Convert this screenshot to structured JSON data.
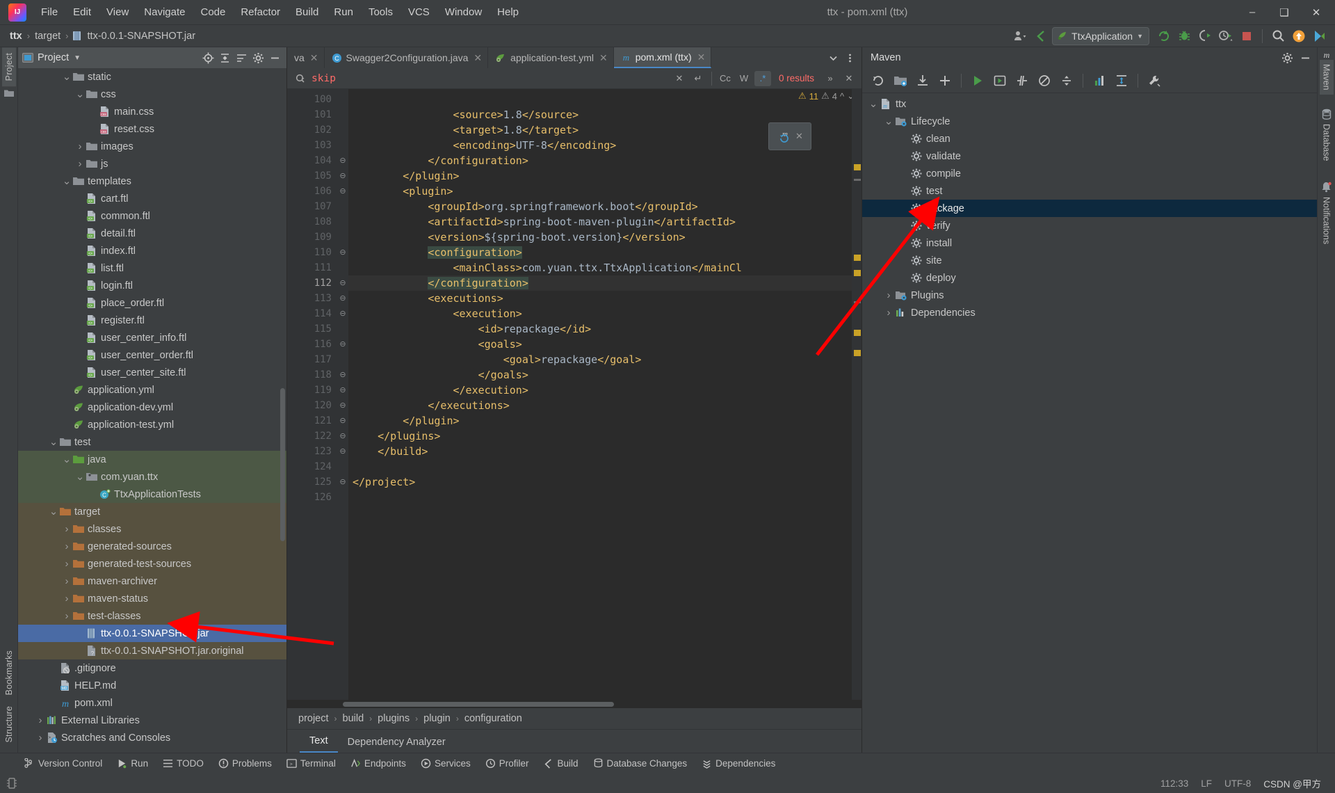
{
  "window": {
    "title": "ttx - pom.xml (ttx)",
    "logo_alt": "intellij-idea-logo",
    "minimize": "—",
    "maximize": "❐",
    "close": "✕"
  },
  "menubar": [
    "File",
    "Edit",
    "View",
    "Navigate",
    "Code",
    "Refactor",
    "Build",
    "Run",
    "Tools",
    "VCS",
    "Window",
    "Help"
  ],
  "navbar": {
    "crumbs": [
      "ttx",
      "target",
      "ttx-0.0.1-SNAPSHOT.jar"
    ],
    "separator": "›",
    "run_config": "TtxApplication",
    "buttons": [
      "profile-icon",
      "updates-icon",
      "run-icon",
      "debug-icon",
      "coverage-icon",
      "profiler-icon",
      "stop-icon",
      "search-everywhere-icon",
      "notification-icon",
      "feedback-icon"
    ]
  },
  "left_rail": {
    "tabs": [
      "Project",
      "Bookmarks",
      "Structure"
    ]
  },
  "project_panel": {
    "title": "Project",
    "header_icons": [
      "locate-icon",
      "collapse-all-icon",
      "expand-icon",
      "settings-icon",
      "hide-icon"
    ],
    "tree": [
      {
        "label": "static",
        "indent": 3,
        "arrow": "down",
        "icon": "folder-gray",
        "state": "normal"
      },
      {
        "label": "css",
        "indent": 4,
        "arrow": "down",
        "icon": "folder-gray",
        "state": "normal"
      },
      {
        "label": "main.css",
        "indent": 5,
        "arrow": "none",
        "icon": "css-file",
        "state": "normal"
      },
      {
        "label": "reset.css",
        "indent": 5,
        "arrow": "none",
        "icon": "css-file",
        "state": "normal"
      },
      {
        "label": "images",
        "indent": 4,
        "arrow": "right",
        "icon": "folder-gray",
        "state": "normal"
      },
      {
        "label": "js",
        "indent": 4,
        "arrow": "right",
        "icon": "folder-gray",
        "state": "normal"
      },
      {
        "label": "templates",
        "indent": 3,
        "arrow": "down",
        "icon": "folder-gray",
        "state": "normal"
      },
      {
        "label": "cart.ftl",
        "indent": 4,
        "arrow": "none",
        "icon": "ftl-file",
        "state": "normal"
      },
      {
        "label": "common.ftl",
        "indent": 4,
        "arrow": "none",
        "icon": "ftl-file",
        "state": "normal"
      },
      {
        "label": "detail.ftl",
        "indent": 4,
        "arrow": "none",
        "icon": "ftl-file",
        "state": "normal"
      },
      {
        "label": "index.ftl",
        "indent": 4,
        "arrow": "none",
        "icon": "ftl-file",
        "state": "normal"
      },
      {
        "label": "list.ftl",
        "indent": 4,
        "arrow": "none",
        "icon": "ftl-file",
        "state": "normal"
      },
      {
        "label": "login.ftl",
        "indent": 4,
        "arrow": "none",
        "icon": "ftl-file",
        "state": "normal"
      },
      {
        "label": "place_order.ftl",
        "indent": 4,
        "arrow": "none",
        "icon": "ftl-file",
        "state": "normal"
      },
      {
        "label": "register.ftl",
        "indent": 4,
        "arrow": "none",
        "icon": "ftl-file",
        "state": "normal"
      },
      {
        "label": "user_center_info.ftl",
        "indent": 4,
        "arrow": "none",
        "icon": "ftl-file",
        "state": "normal"
      },
      {
        "label": "user_center_order.ftl",
        "indent": 4,
        "arrow": "none",
        "icon": "ftl-file",
        "state": "normal"
      },
      {
        "label": "user_center_site.ftl",
        "indent": 4,
        "arrow": "none",
        "icon": "ftl-file",
        "state": "normal"
      },
      {
        "label": "application.yml",
        "indent": 3,
        "arrow": "none",
        "icon": "yml-file",
        "state": "normal"
      },
      {
        "label": "application-dev.yml",
        "indent": 3,
        "arrow": "none",
        "icon": "yml-file",
        "state": "normal"
      },
      {
        "label": "application-test.yml",
        "indent": 3,
        "arrow": "none",
        "icon": "yml-file",
        "state": "normal"
      },
      {
        "label": "test",
        "indent": 2,
        "arrow": "down",
        "icon": "folder-gray",
        "state": "normal"
      },
      {
        "label": "java",
        "indent": 3,
        "arrow": "down",
        "icon": "folder-green",
        "state": "test"
      },
      {
        "label": "com.yuan.ttx",
        "indent": 4,
        "arrow": "down",
        "icon": "package",
        "state": "test"
      },
      {
        "label": "TtxApplicationTests",
        "indent": 5,
        "arrow": "none",
        "icon": "test-class",
        "state": "test"
      },
      {
        "label": "target",
        "indent": 2,
        "arrow": "down",
        "icon": "folder-orange",
        "state": "target"
      },
      {
        "label": "classes",
        "indent": 3,
        "arrow": "right",
        "icon": "folder-orange",
        "state": "target"
      },
      {
        "label": "generated-sources",
        "indent": 3,
        "arrow": "right",
        "icon": "folder-orange",
        "state": "target"
      },
      {
        "label": "generated-test-sources",
        "indent": 3,
        "arrow": "right",
        "icon": "folder-orange",
        "state": "target"
      },
      {
        "label": "maven-archiver",
        "indent": 3,
        "arrow": "right",
        "icon": "folder-orange",
        "state": "target"
      },
      {
        "label": "maven-status",
        "indent": 3,
        "arrow": "right",
        "icon": "folder-orange",
        "state": "target"
      },
      {
        "label": "test-classes",
        "indent": 3,
        "arrow": "right",
        "icon": "folder-orange",
        "state": "target"
      },
      {
        "label": "ttx-0.0.1-SNAPSHOT.jar",
        "indent": 4,
        "arrow": "none",
        "icon": "jar-file",
        "state": "selected"
      },
      {
        "label": "ttx-0.0.1-SNAPSHOT.jar.original",
        "indent": 4,
        "arrow": "none",
        "icon": "unknown-file",
        "state": "target"
      },
      {
        "label": ".gitignore",
        "indent": 2,
        "arrow": "none",
        "icon": "gitignore-file",
        "state": "normal"
      },
      {
        "label": "HELP.md",
        "indent": 2,
        "arrow": "none",
        "icon": "md-file",
        "state": "normal"
      },
      {
        "label": "pom.xml",
        "indent": 2,
        "arrow": "none",
        "icon": "maven-file",
        "state": "normal"
      },
      {
        "label": "External Libraries",
        "indent": 1,
        "arrow": "right",
        "icon": "libraries",
        "state": "normal"
      },
      {
        "label": "Scratches and Consoles",
        "indent": 1,
        "arrow": "right",
        "icon": "scratches",
        "state": "normal"
      }
    ]
  },
  "editor": {
    "tabs": [
      {
        "label": "va",
        "icon": "java-file",
        "active": false,
        "truncated": true
      },
      {
        "label": "Swagger2Configuration.java",
        "icon": "java-class",
        "active": false
      },
      {
        "label": "application-test.yml",
        "icon": "yml-file",
        "active": false
      },
      {
        "label": "pom.xml (ttx)",
        "icon": "maven-file",
        "active": true
      }
    ],
    "tab_right_icons": [
      "chevron-down-icon",
      "more-options-icon"
    ],
    "find": {
      "value": "skip",
      "results": "0 results",
      "case_label": "Cc",
      "words_label": "W",
      "regex_label": ".*",
      "close_label": "✕",
      "clear_label": "✕",
      "newline_label": "↵",
      "expand_label": "»"
    },
    "inspections": {
      "warnings": "11",
      "weak_warnings": "4"
    },
    "lines": [
      {
        "num": "100",
        "indent": 0,
        "text": "",
        "partial": true
      },
      {
        "num": "101",
        "indent": 4,
        "text": "<source>1.8</source>"
      },
      {
        "num": "102",
        "indent": 4,
        "text": "<target>1.8</target>"
      },
      {
        "num": "103",
        "indent": 4,
        "text": "<encoding>UTF-8</encoding>"
      },
      {
        "num": "104",
        "indent": 3,
        "text": "</configuration>",
        "fold": true
      },
      {
        "num": "105",
        "indent": 2,
        "text": "</plugin>",
        "fold": true
      },
      {
        "num": "106",
        "indent": 2,
        "text": "<plugin>",
        "fold": true
      },
      {
        "num": "107",
        "indent": 3,
        "text": "<groupId>org.springframework.boot</groupId>"
      },
      {
        "num": "108",
        "indent": 3,
        "text": "<artifactId>spring-boot-maven-plugin</artifactId>"
      },
      {
        "num": "109",
        "indent": 3,
        "text": "<version>${spring-boot.version}</version>"
      },
      {
        "num": "110",
        "indent": 3,
        "text": "<configuration>",
        "fold": true,
        "highlight": true
      },
      {
        "num": "111",
        "indent": 4,
        "text": "<mainClass>com.yuan.ttx.TtxApplication</mainCl"
      },
      {
        "num": "112",
        "indent": 3,
        "text": "</configuration>",
        "fold": true,
        "highlight": true,
        "current": true
      },
      {
        "num": "113",
        "indent": 3,
        "text": "<executions>",
        "fold": true
      },
      {
        "num": "114",
        "indent": 4,
        "text": "<execution>",
        "fold": true
      },
      {
        "num": "115",
        "indent": 5,
        "text": "<id>repackage</id>"
      },
      {
        "num": "116",
        "indent": 5,
        "text": "<goals>",
        "fold": true
      },
      {
        "num": "117",
        "indent": 6,
        "text": "<goal>repackage</goal>"
      },
      {
        "num": "118",
        "indent": 5,
        "text": "</goals>",
        "fold": true
      },
      {
        "num": "119",
        "indent": 4,
        "text": "</execution>",
        "fold": true
      },
      {
        "num": "120",
        "indent": 3,
        "text": "</executions>",
        "fold": true
      },
      {
        "num": "121",
        "indent": 2,
        "text": "</plugin>",
        "fold": true
      },
      {
        "num": "122",
        "indent": 1,
        "text": "</plugins>",
        "fold": true
      },
      {
        "num": "123",
        "indent": 1,
        "text": "</build>",
        "fold": true
      },
      {
        "num": "124",
        "indent": 0,
        "text": ""
      },
      {
        "num": "125",
        "indent": 0,
        "text": "</project>",
        "fold": true
      },
      {
        "num": "126",
        "indent": 0,
        "text": ""
      }
    ],
    "breadcrumbs": [
      "project",
      "build",
      "plugins",
      "plugin",
      "configuration"
    ],
    "breadcrumb_separator": "›",
    "subtabs": [
      {
        "label": "Text",
        "active": true
      },
      {
        "label": "Dependency Analyzer",
        "active": false
      }
    ]
  },
  "maven_panel": {
    "title": "Maven",
    "header_icons": [
      "settings-icon",
      "hide-icon"
    ],
    "toolbar_icons": [
      "reload-icon",
      "add-module-icon",
      "download-sources-icon",
      "add-icon",
      "run-icon",
      "run-configuration-icon",
      "skip-tests-icon",
      "offline-icon",
      "toggle-icon",
      "profiler-icon",
      "expand-icon",
      "wrench-icon"
    ],
    "tree": [
      {
        "label": "ttx",
        "indent": 0,
        "arrow": "down",
        "icon": "maven-project",
        "selected": false
      },
      {
        "label": "Lifecycle",
        "indent": 1,
        "arrow": "down",
        "icon": "lifecycle-folder",
        "selected": false
      },
      {
        "label": "clean",
        "indent": 2,
        "arrow": "none",
        "icon": "goal-icon",
        "selected": false
      },
      {
        "label": "validate",
        "indent": 2,
        "arrow": "none",
        "icon": "goal-icon",
        "selected": false
      },
      {
        "label": "compile",
        "indent": 2,
        "arrow": "none",
        "icon": "goal-icon",
        "selected": false
      },
      {
        "label": "test",
        "indent": 2,
        "arrow": "none",
        "icon": "goal-icon",
        "selected": false
      },
      {
        "label": "package",
        "indent": 2,
        "arrow": "none",
        "icon": "goal-icon",
        "selected": true
      },
      {
        "label": "verify",
        "indent": 2,
        "arrow": "none",
        "icon": "goal-icon",
        "selected": false
      },
      {
        "label": "install",
        "indent": 2,
        "arrow": "none",
        "icon": "goal-icon",
        "selected": false
      },
      {
        "label": "site",
        "indent": 2,
        "arrow": "none",
        "icon": "goal-icon",
        "selected": false
      },
      {
        "label": "deploy",
        "indent": 2,
        "arrow": "none",
        "icon": "goal-icon",
        "selected": false
      },
      {
        "label": "Plugins",
        "indent": 1,
        "arrow": "right",
        "icon": "lifecycle-folder",
        "selected": false
      },
      {
        "label": "Dependencies",
        "indent": 1,
        "arrow": "right",
        "icon": "dependencies-icon",
        "selected": false
      }
    ]
  },
  "right_rail": {
    "tabs": [
      "Maven",
      "Database",
      "Notifications"
    ]
  },
  "bottom_toolwindows": [
    {
      "label": "Version Control",
      "icon": "vcs-icon"
    },
    {
      "label": "Run",
      "icon": "run-icon"
    },
    {
      "label": "TODO",
      "icon": "todo-icon"
    },
    {
      "label": "Problems",
      "icon": "problems-icon"
    },
    {
      "label": "Terminal",
      "icon": "terminal-icon"
    },
    {
      "label": "Endpoints",
      "icon": "endpoints-icon"
    },
    {
      "label": "Services",
      "icon": "services-icon"
    },
    {
      "label": "Profiler",
      "icon": "profiler-icon"
    },
    {
      "label": "Build",
      "icon": "build-icon"
    },
    {
      "label": "Database Changes",
      "icon": "database-changes-icon"
    },
    {
      "label": "Dependencies",
      "icon": "dependencies-icon"
    }
  ],
  "statusbar": {
    "caret_position": "112:33",
    "line_separator": "LF",
    "encoding": "UTF-8",
    "watermark": "CSDN @甲方"
  },
  "colors": {
    "accent_blue": "#4a88c7",
    "selection_blue": "#4a6ba5",
    "maven_selection": "#0d293e",
    "test_scope": "#4c5845",
    "target_scope": "#57513f",
    "find_text": "#ff6b68",
    "arrow_red": "#ff0000",
    "tag": "#e8bf6a",
    "text": "#a9b7c6"
  }
}
